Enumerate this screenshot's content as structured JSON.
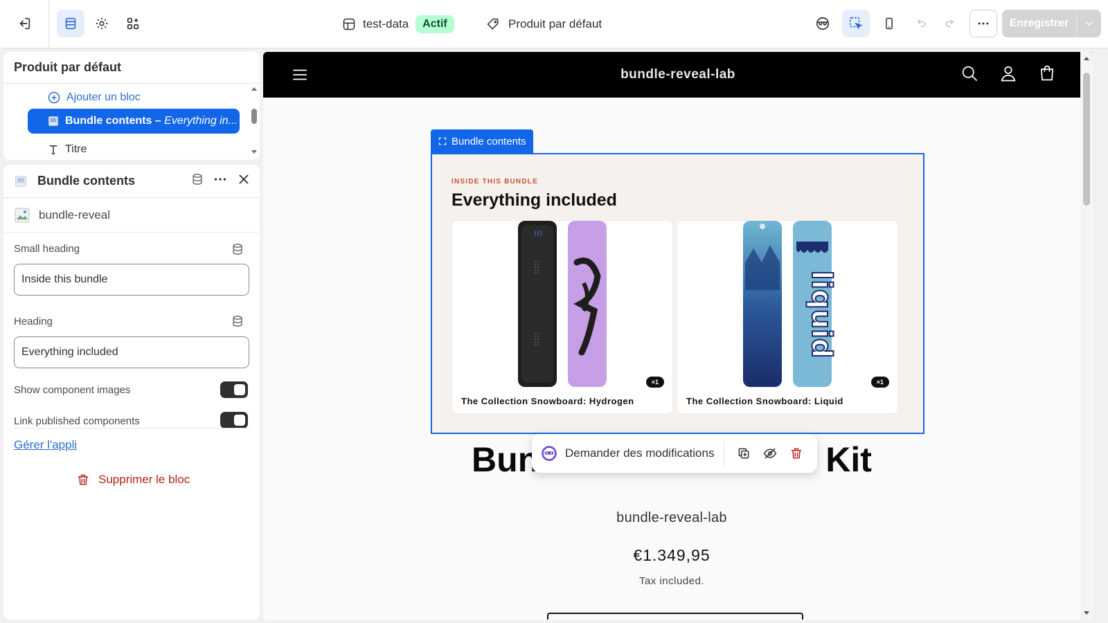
{
  "toolbar": {
    "theme_name": "test-data",
    "theme_status": "Actif",
    "template_name": "Produit par défaut",
    "save_label": "Enregistrer"
  },
  "sidebar": {
    "template_title": "Produit par défaut",
    "add_block_label": "Ajouter un bloc",
    "selected_block_name": "Bundle contents",
    "selected_block_sub": "Everything in...",
    "next_block_label": "Titre"
  },
  "settings": {
    "block_title": "Bundle contents",
    "app_name": "bundle-reveal",
    "small_heading_label": "Small heading",
    "small_heading_value": "Inside this bundle",
    "heading_label": "Heading",
    "heading_value": "Everything included",
    "show_images_label": "Show component images",
    "show_images_on": true,
    "link_components_label": "Link published components",
    "link_components_on": true,
    "manage_app_label": "Gérer l'appli",
    "delete_block_label": "Supprimer le bloc"
  },
  "preview": {
    "shop_name": "bundle-reveal-lab",
    "block_tag": "Bundle contents",
    "bundle_small_heading": "Inside this bundle",
    "bundle_heading": "Everything included",
    "products": [
      {
        "title": "The Collection Snowboard: Hydrogen",
        "qty": "×1"
      },
      {
        "title": "The Collection Snowboard: Liquid",
        "qty": "×1"
      }
    ],
    "product_title": "Bundle Reveal Demo Kit",
    "vendor": "bundle-reveal-lab",
    "price": "€1.349,95",
    "tax_note": "Tax included.",
    "ask_changes_label": "Demander des modifications"
  },
  "colors": {
    "accent_blue": "#1266e8",
    "status_green": "#b4fed2",
    "danger": "#b42318"
  }
}
